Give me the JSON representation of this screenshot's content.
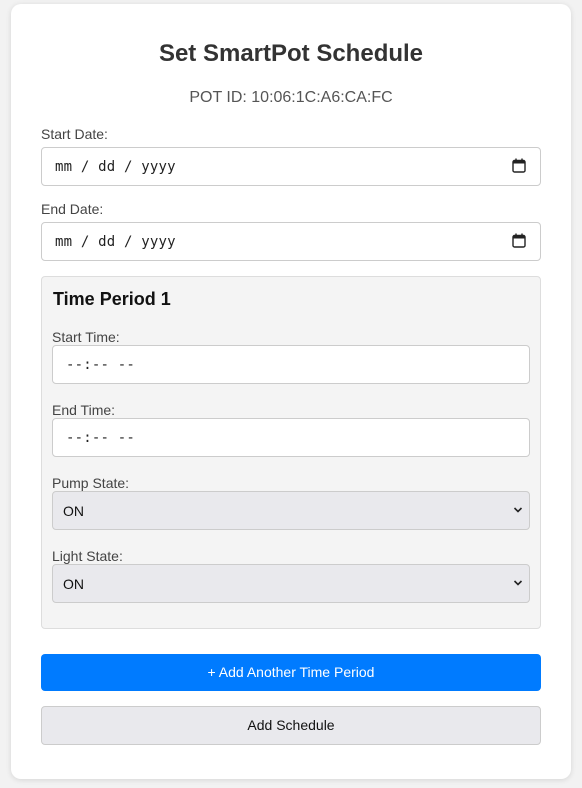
{
  "header": {
    "title": "Set SmartPot Schedule",
    "pot_id": "POT ID: 10:06:1C:A6:CA:FC"
  },
  "dates": {
    "start_label": "Start Date:",
    "start_value": "mm / dd / yyyy",
    "end_label": "End Date:",
    "end_value": "mm / dd / yyyy"
  },
  "period": {
    "title": "Time Period 1",
    "start_time_label": "Start Time:",
    "start_time_value": "--:-- --",
    "end_time_label": "End Time:",
    "end_time_value": "--:-- --",
    "pump_label": "Pump State:",
    "pump_value": "ON",
    "light_label": "Light State:",
    "light_value": "ON"
  },
  "buttons": {
    "add_period": "+ Add Another Time Period",
    "add_schedule": "Add Schedule"
  },
  "colors": {
    "primary": "#007bff",
    "secondary_bg": "#e9e9ed",
    "period_bg": "#f4f4f4"
  }
}
